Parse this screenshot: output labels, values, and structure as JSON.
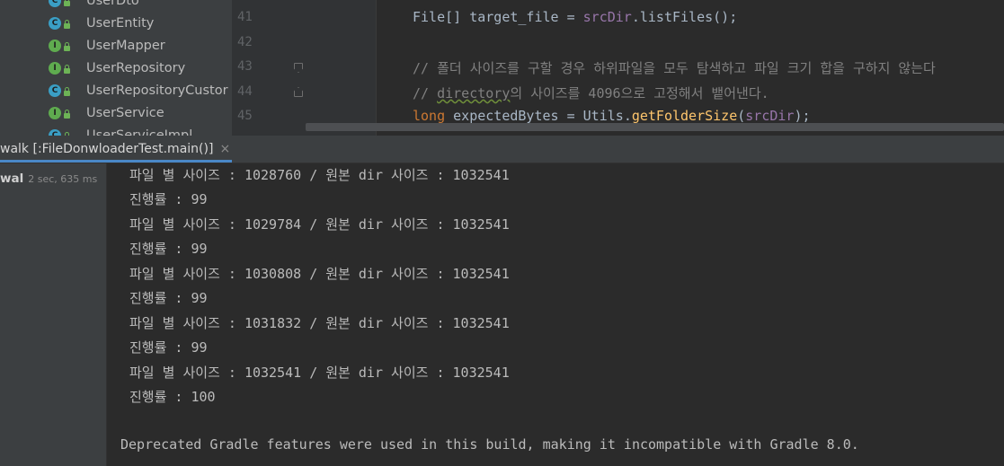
{
  "project_tree": {
    "items": [
      {
        "label": "UserDto",
        "kind": "C"
      },
      {
        "label": "UserEntity",
        "kind": "C"
      },
      {
        "label": "UserMapper",
        "kind": "I"
      },
      {
        "label": "UserRepository",
        "kind": "I"
      },
      {
        "label": "UserRepositoryCustor",
        "kind": "C"
      },
      {
        "label": "UserService",
        "kind": "I"
      },
      {
        "label": "UserServiceImpl",
        "kind": "C"
      }
    ]
  },
  "editor": {
    "lines": [
      {
        "number": "41"
      },
      {
        "number": "42"
      },
      {
        "number": "43"
      },
      {
        "number": "44"
      },
      {
        "number": "45"
      }
    ],
    "code": {
      "l41": {
        "type": "File",
        "rest1": "[] target_file = ",
        "obj": "srcDir",
        "dot": ".",
        "method": "listFiles",
        "end": "();"
      },
      "l43": {
        "comment": "// 폴더 사이즈를 구할 경우 하위파일을 모두 탐색하고 파일 크기 합을 구하지 않는다"
      },
      "l44": {
        "prefix": "// ",
        "word": "directory",
        "suffix": "의 사이즈를 4096으로 고정해서 뱉어낸다."
      },
      "l45": {
        "keyword": "long",
        "var": " expectedBytes = ",
        "cls": "Utils",
        "dot": ".",
        "method": "getFolderSize",
        "open": "(",
        "arg": "srcDir",
        "close": ");"
      }
    }
  },
  "run_window": {
    "tab_label": "walk [:FileDonwloaderTest.main()]",
    "close_icon": "×",
    "tree_node": {
      "name": "wal",
      "time": "2 sec, 635 ms"
    }
  },
  "console": {
    "lines": [
      "파일 별 사이즈 : 1028760 / 원본 dir 사이즈 : 1032541",
      "진행률 : 99",
      "파일 별 사이즈 : 1029784 / 원본 dir 사이즈 : 1032541",
      "진행률 : 99",
      "파일 별 사이즈 : 1030808 / 원본 dir 사이즈 : 1032541",
      "진행률 : 99",
      "파일 별 사이즈 : 1031832 / 원본 dir 사이즈 : 1032541",
      "진행률 : 99",
      "파일 별 사이즈 : 1032541 / 원본 dir 사이즈 : 1032541",
      "진행률 : 100"
    ],
    "footer": "Deprecated Gradle features were used in this build, making it incompatible with Gradle 8.0."
  }
}
